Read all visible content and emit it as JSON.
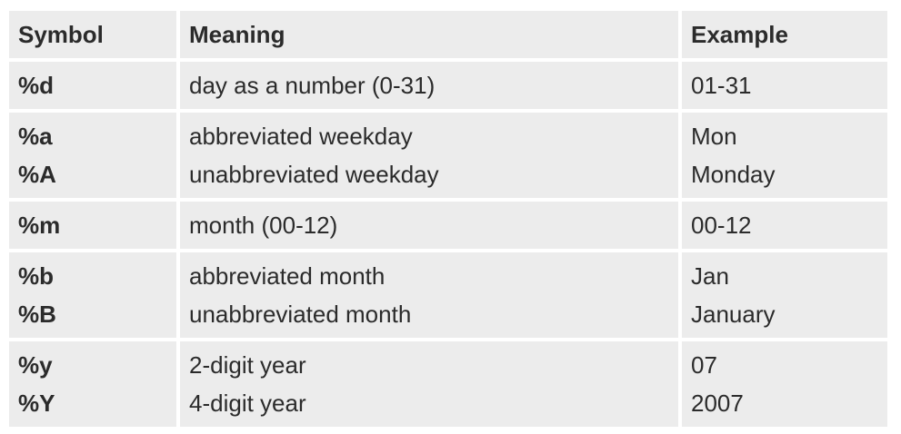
{
  "table": {
    "headers": {
      "symbol": "Symbol",
      "meaning": "Meaning",
      "example": "Example"
    },
    "rows": [
      {
        "symbols": [
          "%d"
        ],
        "meanings": [
          "day as a number (0-31)"
        ],
        "examples": [
          "01-31"
        ]
      },
      {
        "symbols": [
          "%a",
          "%A"
        ],
        "meanings": [
          "abbreviated weekday",
          "unabbreviated weekday"
        ],
        "examples": [
          "Mon",
          "Monday"
        ]
      },
      {
        "symbols": [
          "%m"
        ],
        "meanings": [
          "month (00-12)"
        ],
        "examples": [
          "00-12"
        ]
      },
      {
        "symbols": [
          "%b",
          "%B"
        ],
        "meanings": [
          "abbreviated month",
          "unabbreviated month"
        ],
        "examples": [
          "Jan",
          "January"
        ]
      },
      {
        "symbols": [
          "%y",
          "%Y"
        ],
        "meanings": [
          "2-digit year",
          "4-digit year"
        ],
        "examples": [
          "07",
          "2007"
        ]
      }
    ]
  }
}
